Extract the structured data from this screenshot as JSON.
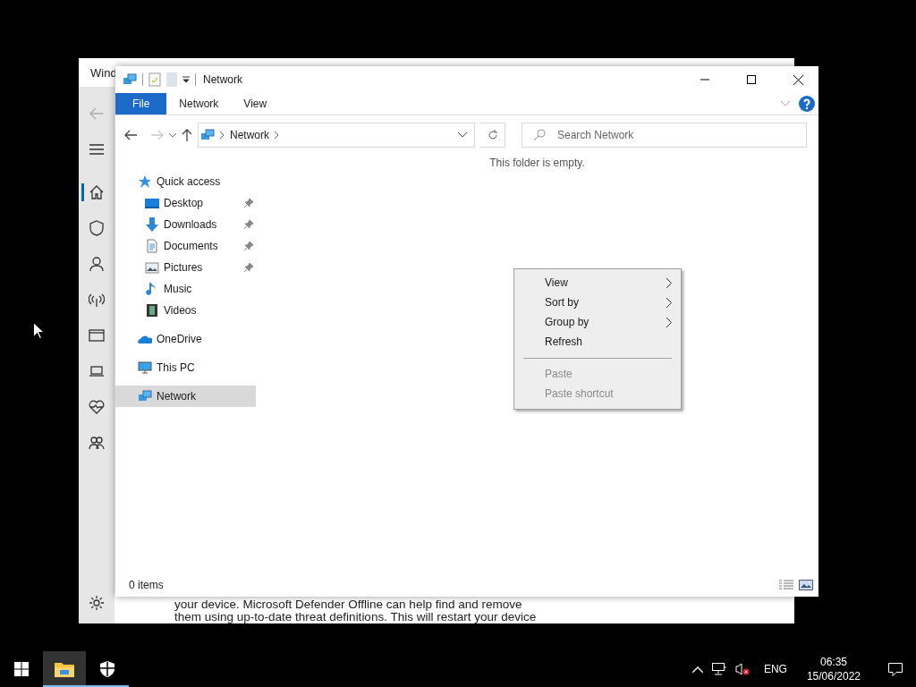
{
  "background_window": {
    "title": "Wind",
    "rail_items": [
      {
        "kind": "back",
        "selected": false
      },
      {
        "kind": "menu",
        "selected": false
      },
      {
        "kind": "home",
        "selected": true
      },
      {
        "kind": "shield",
        "selected": false
      },
      {
        "kind": "person",
        "selected": false
      },
      {
        "kind": "antenna",
        "selected": false
      },
      {
        "kind": "window",
        "selected": false
      },
      {
        "kind": "laptop",
        "selected": false
      },
      {
        "kind": "heart",
        "selected": false
      },
      {
        "kind": "family",
        "selected": false
      }
    ],
    "body_lines": [
      "your device. Microsoft Defender Offline can help find and remove",
      "them using up-to-date threat definitions. This will restart your device"
    ]
  },
  "explorer": {
    "title": "Network",
    "ribbon_tabs": [
      {
        "label": "File",
        "kind": "file"
      },
      {
        "label": "Network",
        "kind": "tab"
      },
      {
        "label": "View",
        "kind": "tab"
      }
    ],
    "address": {
      "crumbs": [
        "Network"
      ]
    },
    "search": {
      "placeholder": "Search Network"
    },
    "nav_tree": [
      {
        "label": "Quick access",
        "kind": "star",
        "selected": false,
        "children": [
          {
            "label": "Desktop",
            "kind": "desktop",
            "pinned": true,
            "selected": false
          },
          {
            "label": "Downloads",
            "kind": "download",
            "pinned": true,
            "selected": false
          },
          {
            "label": "Documents",
            "kind": "document",
            "pinned": true,
            "selected": false
          },
          {
            "label": "Pictures",
            "kind": "pictures",
            "pinned": true,
            "selected": false
          },
          {
            "label": "Music",
            "kind": "music",
            "pinned": false,
            "selected": false
          },
          {
            "label": "Videos",
            "kind": "videos",
            "pinned": false,
            "selected": false
          }
        ]
      },
      {
        "label": "OneDrive",
        "kind": "cloud",
        "selected": false
      },
      {
        "label": "This PC",
        "kind": "pc",
        "selected": false
      },
      {
        "label": "Network",
        "kind": "network",
        "selected": true
      }
    ],
    "empty_message": "This folder is empty.",
    "status_bar": {
      "item_count": "0 items"
    }
  },
  "context_menu": [
    {
      "kind": "item",
      "label": "View",
      "submenu": true,
      "disabled": false
    },
    {
      "kind": "item",
      "label": "Sort by",
      "submenu": true,
      "disabled": false
    },
    {
      "kind": "item",
      "label": "Group by",
      "submenu": true,
      "disabled": false
    },
    {
      "kind": "item",
      "label": "Refresh",
      "submenu": false,
      "disabled": false
    },
    {
      "kind": "separator"
    },
    {
      "kind": "item",
      "label": "Paste",
      "submenu": false,
      "disabled": true
    },
    {
      "kind": "item",
      "label": "Paste shortcut",
      "submenu": false,
      "disabled": true
    }
  ],
  "taskbar": {
    "apps": [
      {
        "kind": "explorer",
        "selected": true
      },
      {
        "kind": "shield",
        "selected": false
      }
    ],
    "language": "ENG",
    "time": "06:35",
    "date": "15/06/2022"
  }
}
